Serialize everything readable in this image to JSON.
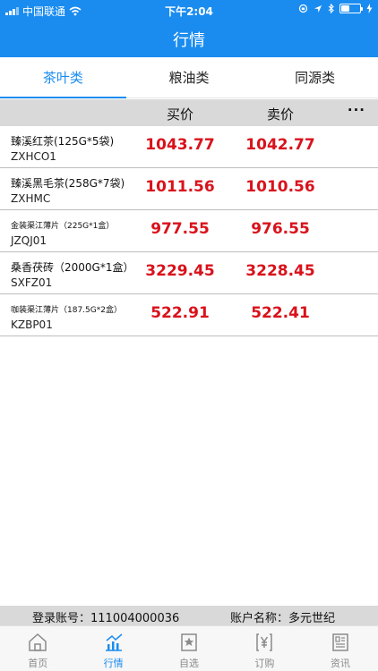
{
  "status_bar": {
    "carrier": "中国联通",
    "time": "下午2:04"
  },
  "nav": {
    "title": "行情"
  },
  "category_tabs": [
    {
      "label": "茶叶类",
      "active": true
    },
    {
      "label": "粮油类",
      "active": false
    },
    {
      "label": "同源类",
      "active": false
    }
  ],
  "table": {
    "headers": {
      "buy": "买价",
      "sell": "卖价",
      "more": "···"
    },
    "rows": [
      {
        "name": "臻溪红茶(125G*5袋)",
        "code": "ZXHCO1",
        "buy": "1043.77",
        "sell": "1042.77"
      },
      {
        "name": "臻溪黑毛茶(258G*7袋)",
        "code": "ZXHMC",
        "buy": "1011.56",
        "sell": "1010.56"
      },
      {
        "name": "金装渠江薄片（225G*1盒）",
        "code": "JZQJ01",
        "buy": "977.55",
        "sell": "976.55"
      },
      {
        "name": "桑香茯砖（2000G*1盒）",
        "code": "SXFZ01",
        "buy": "3229.45",
        "sell": "3228.45"
      },
      {
        "name": "咖装渠江薄片（187.5G*2盒）",
        "code": "KZBP01",
        "buy": "522.91",
        "sell": "522.41"
      }
    ]
  },
  "account": {
    "account_label": "登录账号：111004000036",
    "holder_label": "账户名称：多元世纪"
  },
  "bottom_tabs": [
    {
      "label": "首页",
      "icon": "home-icon",
      "active": false
    },
    {
      "label": "行情",
      "icon": "chart-icon",
      "active": true
    },
    {
      "label": "自选",
      "icon": "star-icon",
      "active": false
    },
    {
      "label": "订购",
      "icon": "yen-icon",
      "active": false
    },
    {
      "label": "资讯",
      "icon": "news-icon",
      "active": false
    }
  ],
  "colors": {
    "primary": "#1a8cf0",
    "price": "#d9121b",
    "header_bg": "#d9d9d9"
  }
}
